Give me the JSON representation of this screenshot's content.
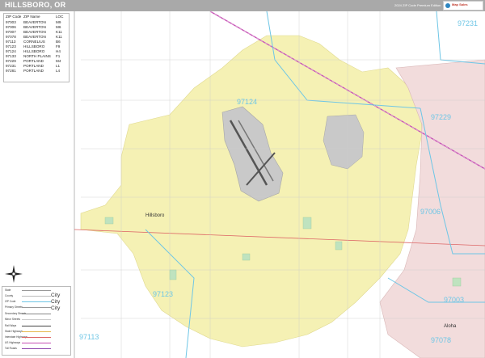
{
  "header": {
    "title": "HILLSBORO, OR",
    "edition": "2024 ZIP Code Premium Edition",
    "brand": "Map Sales",
    "bar_color": "#a9a9a9"
  },
  "zip_table": {
    "columns": [
      "ZIP Code",
      "ZIP Name",
      "LOC"
    ],
    "rows": [
      {
        "zip": "97003",
        "name": "BEAVERTON",
        "loc": "M9"
      },
      {
        "zip": "97006",
        "name": "BEAVERTON",
        "loc": "M6"
      },
      {
        "zip": "97007",
        "name": "BEAVERTON",
        "loc": "K11"
      },
      {
        "zip": "97078",
        "name": "BEAVERTON",
        "loc": "K11"
      },
      {
        "zip": "97113",
        "name": "CORNELIUS",
        "loc": "B6"
      },
      {
        "zip": "97123",
        "name": "HILLSBORO",
        "loc": "F9"
      },
      {
        "zip": "97124",
        "name": "HILLSBORO",
        "loc": "H4"
      },
      {
        "zip": "97133",
        "name": "NORTH PLAINS",
        "loc": "F1"
      },
      {
        "zip": "97229",
        "name": "PORTLAND",
        "loc": "M4"
      },
      {
        "zip": "97231",
        "name": "PORTLAND",
        "loc": "L1"
      },
      {
        "zip": "97281",
        "name": "PORTLAND",
        "loc": "L4"
      }
    ]
  },
  "legend": {
    "rows": [
      "State",
      "County",
      "ZIP Code",
      "Primary Streets",
      "Secondary Streets",
      "Minor Streets",
      "Rail Ways",
      "State Highways",
      "Interstate Highways",
      "US Highways",
      "Toll Roads"
    ],
    "city_labels": [
      "City",
      "City",
      "City"
    ]
  },
  "zip_labels": [
    {
      "code": "97124"
    },
    {
      "code": "97229"
    },
    {
      "code": "97006"
    },
    {
      "code": "97123"
    },
    {
      "code": "97113"
    },
    {
      "code": "97003"
    },
    {
      "code": "97078"
    },
    {
      "code": "97231"
    }
  ],
  "places": {
    "hillsboro": "Hillsboro",
    "aloha": "Aloha"
  },
  "colors": {
    "zip_label": "#6ec6e6",
    "city_fill": "#f3efb2",
    "airport": "#c8c8c8",
    "urban": "#e8c9c9"
  }
}
